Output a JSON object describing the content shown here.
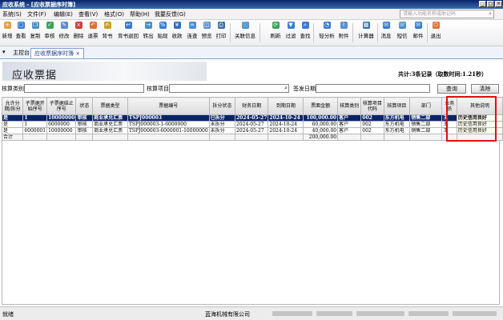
{
  "window": {
    "title": "应收系统 - [应收票据序时簿]"
  },
  "menu": {
    "items": [
      "系统(S)",
      "文件(F)",
      "编辑(E)",
      "查看(V)",
      "格式(O)",
      "帮助(H)",
      "我要反馈(G)"
    ],
    "search_placeholder": "请输入功能名称或助记码"
  },
  "toolbar": {
    "buttons": [
      "新增",
      "查看",
      "复制",
      "审核",
      "修改",
      "删除",
      "退票",
      "背书",
      "背书退回",
      "转出",
      "贴现",
      "收款",
      "连查",
      "预览",
      "打印",
      "关联信息",
      "刷新",
      "过滤",
      "查找",
      "轻分析",
      "附件",
      "计算器",
      "消息",
      "短信",
      "邮件",
      "退出"
    ]
  },
  "tabs": {
    "main": "主控台",
    "active": "应收票据序时簿"
  },
  "page": {
    "title": "应收票据",
    "summary": "共计:3条记录（取数时间:1.21秒）"
  },
  "filters": {
    "label1": "核算类别",
    "label2": "核算项目",
    "label3": "签发日期",
    "query_button": "查询",
    "clear_button": "清除"
  },
  "grid": {
    "columns": [
      "允许分期/拆分",
      "子票据开始序号",
      "子票据结止序号",
      "状态",
      "票据类型",
      "票据编号",
      "拆分状态",
      "财务日期",
      "到期日期",
      "票面金额",
      "核算类别",
      "核算项目代码",
      "核算项目",
      "部门",
      "业务员",
      "其他说明"
    ],
    "rows": [
      [
        "是",
        "1",
        "10000000",
        "审核",
        "商业承兑汇票",
        "TSPJ000003",
        "已拆分",
        "2024-05-27",
        "2024-10-24",
        "100,000.00",
        "客户",
        "002",
        "东方机电",
        "销售二部",
        "王",
        "历史信用良好"
      ],
      [
        "是",
        "1",
        "6000000",
        "审核",
        "商业承兑汇票",
        "TSPJ000003-1-6000000",
        "未拆分",
        "2024-05-27",
        "2024-10-24",
        "60,000.00",
        "客户",
        "002",
        "东方机电",
        "销售二部",
        "王",
        "历史信用良好"
      ],
      [
        "是",
        "6000001",
        "10000000",
        "审核",
        "商业承兑汇票",
        "TSPJ000003-6000001-10000000",
        "未拆分",
        "2024-05-27",
        "2024-10-24",
        "40,000.00",
        "客户",
        "002",
        "东方机电",
        "销售二部",
        "王",
        "历史信用良好"
      ]
    ],
    "total_label": "合计",
    "total_amount": "200,000.00"
  },
  "status": {
    "text": "就绪",
    "company": "蓝海机械有限公司"
  },
  "colors": {
    "title_bar": "#0a246a",
    "selected_row": "#0a246a",
    "highlight": "#e01010"
  }
}
